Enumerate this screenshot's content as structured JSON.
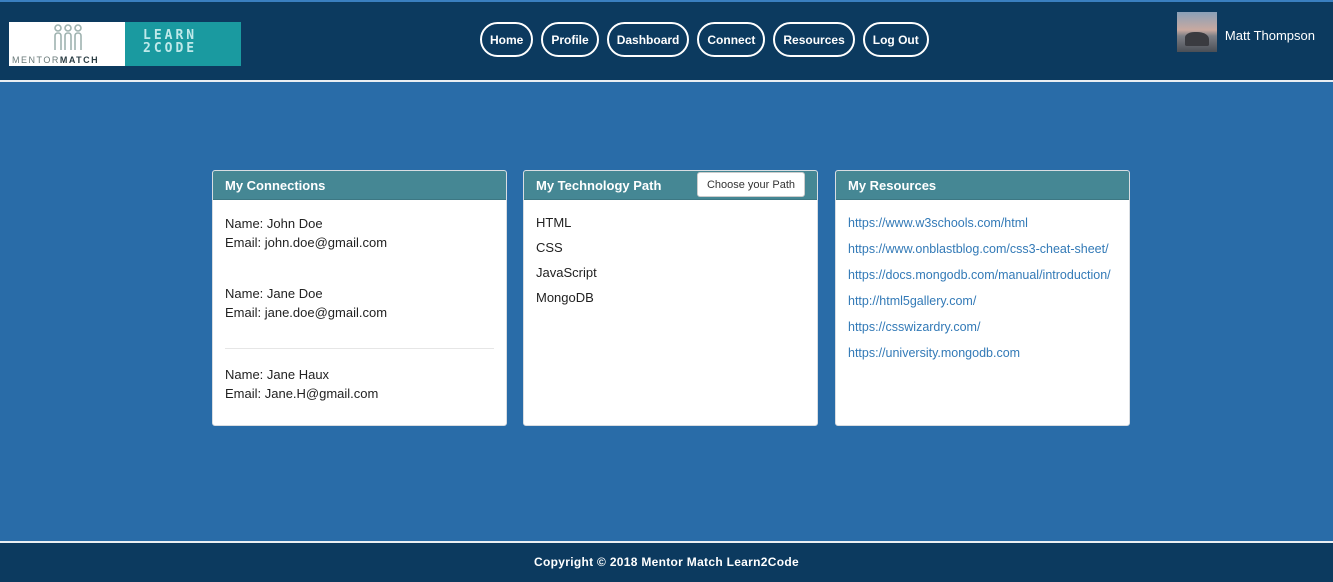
{
  "header": {
    "logo": {
      "mentor_text_a": "MENTOR",
      "mentor_text_b": "MATCH",
      "learn_text": "LEARN\n2CODE"
    },
    "nav": [
      {
        "label": "Home"
      },
      {
        "label": "Profile"
      },
      {
        "label": "Dashboard"
      },
      {
        "label": "Connect"
      },
      {
        "label": "Resources"
      },
      {
        "label": "Log Out"
      }
    ],
    "user": {
      "name": "Matt Thompson"
    }
  },
  "connections": {
    "title": "My Connections",
    "items": [
      {
        "name": "Name: John Doe",
        "email": "Email: john.doe@gmail.com"
      },
      {
        "name": "Name: Jane Doe",
        "email": "Email: jane.doe@gmail.com"
      },
      {
        "name": "Name: Jane Haux",
        "email": "Email: Jane.H@gmail.com"
      }
    ]
  },
  "tech_path": {
    "title": "My Technology Path",
    "choose_label": "Choose your Path",
    "items": [
      "HTML",
      "CSS",
      "JavaScript",
      "MongoDB"
    ]
  },
  "resources": {
    "title": "My Resources",
    "links": [
      "https://www.w3schools.com/html",
      "https://www.onblastblog.com/css3-cheat-sheet/",
      "https://docs.mongodb.com/manual/introduction/",
      "http://html5gallery.com/",
      "https://csswizardry.com/",
      "https://university.mongodb.com"
    ]
  },
  "footer": {
    "copyright": "Copyright © 2018 Mentor Match Learn2Code"
  },
  "colors": {
    "page_bg": "#296ca8",
    "header_bg": "#0c3a5f",
    "card_header": "#458794",
    "link": "#337ab7",
    "logo_teal": "#1a9aa0"
  }
}
